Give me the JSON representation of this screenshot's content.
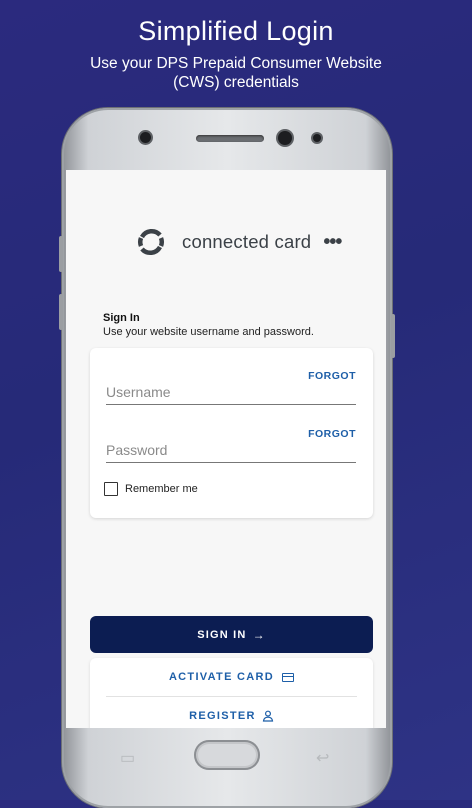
{
  "promo": {
    "title": "Simplified Login",
    "subtitle": "Use your DPS Prepaid Consumer Website (CWS) credentials"
  },
  "app": {
    "brand_name": "connected card",
    "menu_icon": "more-horizontal-icon"
  },
  "signin": {
    "title": "Sign In",
    "subtitle": "Use your website username and password.",
    "username_placeholder": "Username",
    "password_placeholder": "Password",
    "forgot_username_label": "FORGOT",
    "forgot_password_label": "FORGOT",
    "remember_label": "Remember me",
    "remember_checked": false,
    "submit_label": "SIGN IN"
  },
  "actions": {
    "activate_label": "ACTIVATE CARD",
    "activate_icon": "credit-card-icon",
    "register_label": "REGISTER",
    "register_icon": "user-icon"
  },
  "colors": {
    "background": "#2b2a7e",
    "primary_button": "#0c1d52",
    "link": "#1e5fa8"
  }
}
